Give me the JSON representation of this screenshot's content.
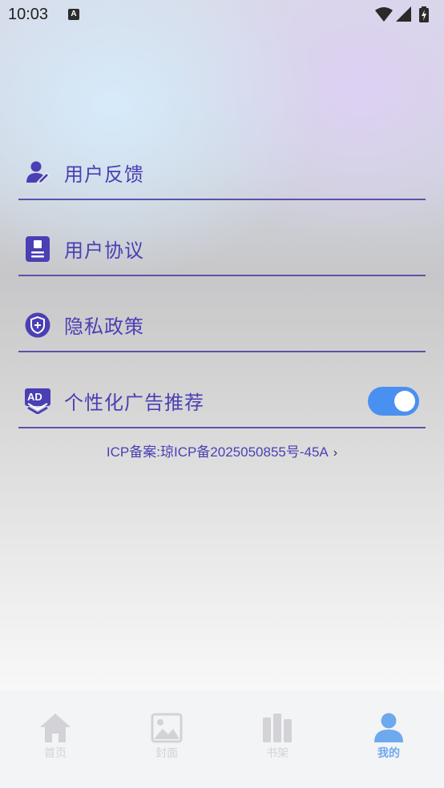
{
  "status_bar": {
    "time": "10:03",
    "notification_badge": "A",
    "icons": [
      "wifi-icon",
      "signal-icon",
      "battery-charging-icon"
    ]
  },
  "menu": {
    "items": [
      {
        "label": "用户反馈",
        "icon": "user-feedback-icon"
      },
      {
        "label": "用户协议",
        "icon": "user-agreement-icon"
      },
      {
        "label": "隐私政策",
        "icon": "privacy-shield-icon"
      },
      {
        "label": "个性化广告推荐",
        "icon": "ad-icon",
        "toggle_on": true
      }
    ]
  },
  "icp": {
    "text": "ICP备案:琼ICP备2025050855号-45A",
    "chevron": "›"
  },
  "tab_bar": {
    "tabs": [
      {
        "label": "首页",
        "icon": "home-icon",
        "active": false
      },
      {
        "label": "封面",
        "icon": "image-icon",
        "active": false
      },
      {
        "label": "书架",
        "icon": "bookshelf-icon",
        "active": false
      },
      {
        "label": "我的",
        "icon": "profile-icon",
        "active": true
      }
    ]
  },
  "colors": {
    "accent_text": "#4a3fb3",
    "divider": "#5c52a8",
    "toggle_on": "#4a90f0",
    "tab_active": "#6ea9ee",
    "tab_inactive": "#d3d3d7"
  }
}
